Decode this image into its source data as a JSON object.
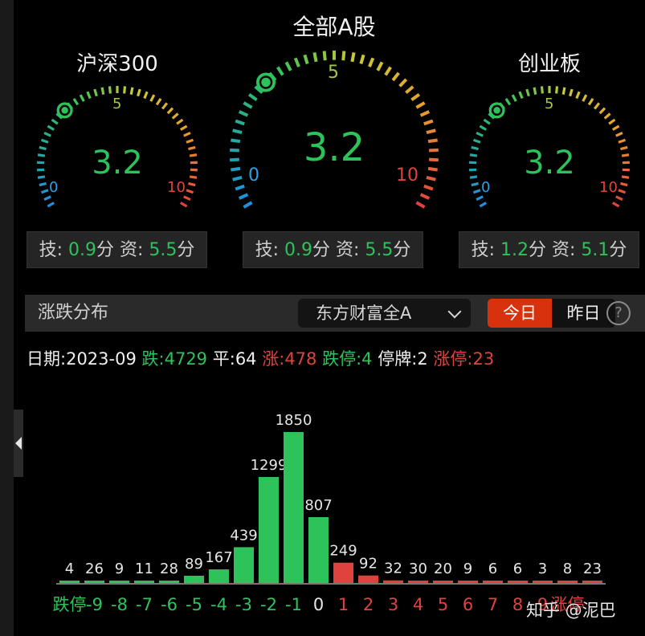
{
  "gauges": [
    {
      "title": "沪深300",
      "value": "3.2",
      "score": 3.2,
      "label_min": "0",
      "label_mid": "5",
      "label_max": "10",
      "tech_label": "技:",
      "tech_value": "0.9",
      "unit1": "分",
      "fund_label": "资:",
      "fund_value": "5.5",
      "unit2": "分"
    },
    {
      "title": "全部A股",
      "value": "3.2",
      "score": 3.2,
      "label_min": "0",
      "label_mid": "5",
      "label_max": "10",
      "tech_label": "技:",
      "tech_value": "0.9",
      "unit1": "分",
      "fund_label": "资:",
      "fund_value": "5.5",
      "unit2": "分"
    },
    {
      "title": "创业板",
      "value": "3.2",
      "score": 3.2,
      "label_min": "0",
      "label_mid": "5",
      "label_max": "10",
      "tech_label": "技:",
      "tech_value": "1.2",
      "unit1": "分",
      "fund_label": "资:",
      "fund_value": "5.1",
      "unit2": "分"
    }
  ],
  "toolbar": {
    "title": "涨跌分布",
    "dropdown_value": "东方财富全A",
    "tab_today": "今日",
    "tab_yesterday": "昨日",
    "help": "?"
  },
  "stats": {
    "date_label": "日期:",
    "date_value": "2023-09",
    "down_label": "跌:",
    "down_value": "4729",
    "flat_label": "平:",
    "flat_value": "64",
    "up_label": "涨:",
    "up_value": "478",
    "limit_down_label": "跌停:",
    "limit_down_value": "4",
    "suspended_label": "停牌:",
    "suspended_value": "2",
    "limit_up_label": "涨停:",
    "limit_up_value": "23"
  },
  "colors": {
    "up": "#e0433d",
    "down": "#2ec35a"
  },
  "chart_data": {
    "type": "bar",
    "categories": [
      "跌停",
      "-9",
      "-8",
      "-7",
      "-6",
      "-5",
      "-4",
      "-3",
      "-2",
      "-1",
      "0",
      "1",
      "2",
      "3",
      "4",
      "5",
      "6",
      "7",
      "8",
      "9",
      "涨停"
    ],
    "values": [
      4,
      26,
      9,
      11,
      28,
      89,
      167,
      439,
      1299,
      1850,
      807,
      249,
      92,
      32,
      30,
      20,
      9,
      6,
      6,
      3,
      8,
      23
    ],
    "bar_colors": [
      "green",
      "green",
      "green",
      "green",
      "green",
      "green",
      "green",
      "green",
      "green",
      "green",
      "green",
      "red",
      "red",
      "red",
      "red",
      "red",
      "red",
      "red",
      "red",
      "red",
      "red",
      "red"
    ]
  },
  "watermark": "知乎 @泥巴"
}
